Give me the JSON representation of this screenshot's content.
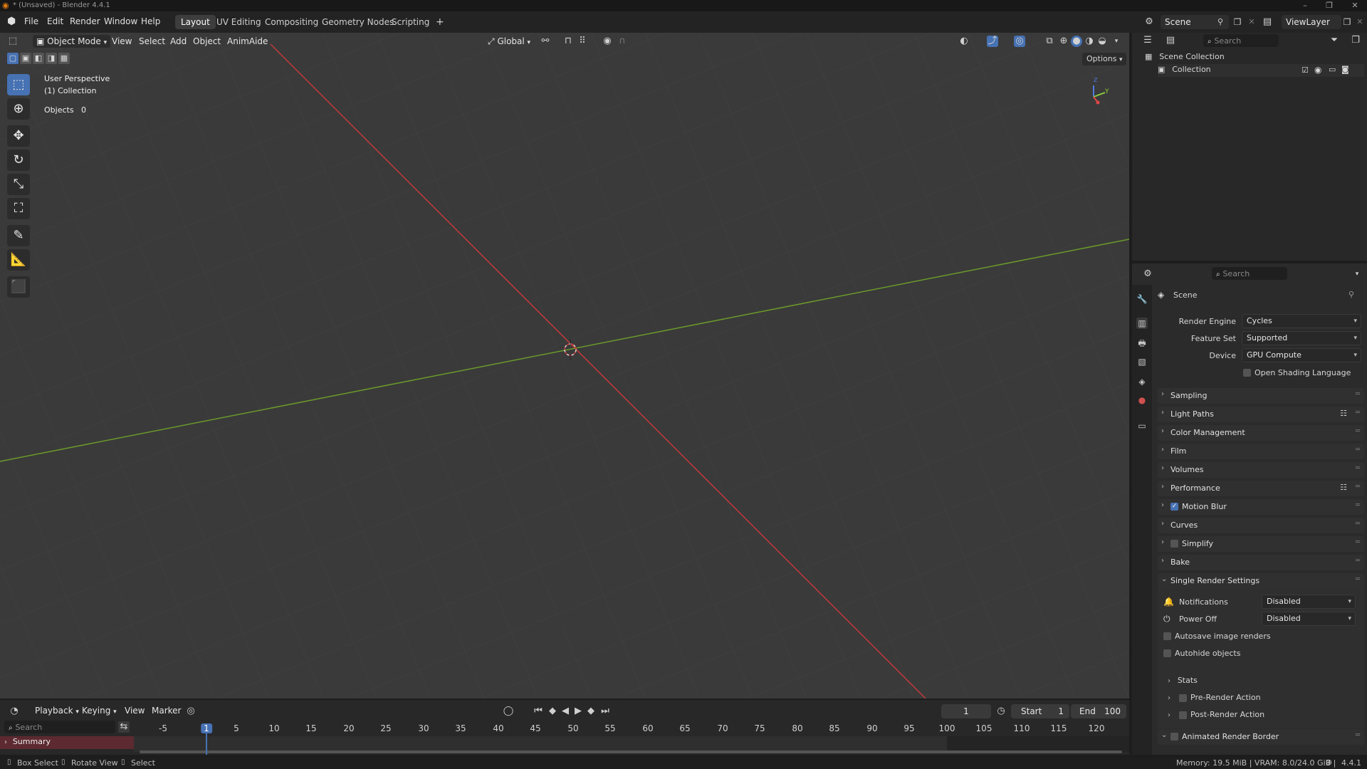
{
  "window": {
    "title": "* (Unsaved) - Blender 4.4.1"
  },
  "menus": [
    "File",
    "Edit",
    "Render",
    "Window",
    "Help"
  ],
  "workspaces": {
    "tabs": [
      "Layout",
      "UV Editing",
      "Compositing",
      "Geometry Nodes",
      "Scripting"
    ],
    "active": "Layout",
    "add": "+"
  },
  "scene_field": "Scene",
  "viewlayer_field": "ViewLayer",
  "viewport_header": {
    "mode": "Object Mode",
    "menus": [
      "View",
      "Select",
      "Add",
      "Object",
      "AnimAide"
    ],
    "transform": "Global",
    "options": "Options"
  },
  "overlay": {
    "perspective": "User Perspective",
    "collection": "(1) Collection",
    "objects_label": "Objects",
    "objects_value": "0"
  },
  "gizmo": {
    "z": "Z",
    "y": "Y"
  },
  "outliner": {
    "search_placeholder": "Search",
    "scene_collection": "Scene Collection",
    "collection": "Collection"
  },
  "properties": {
    "search_placeholder": "Search",
    "context": "Scene",
    "render_engine_label": "Render Engine",
    "render_engine": "Cycles",
    "feature_set_label": "Feature Set",
    "feature_set": "Supported",
    "device_label": "Device",
    "device": "GPU Compute",
    "osl_label": "Open Shading Language",
    "panels": [
      {
        "label": "Sampling"
      },
      {
        "label": "Light Paths"
      },
      {
        "label": "Color Management"
      },
      {
        "label": "Film"
      },
      {
        "label": "Volumes"
      },
      {
        "label": "Performance"
      },
      {
        "label": "Motion Blur"
      },
      {
        "label": "Curves"
      },
      {
        "label": "Simplify"
      },
      {
        "label": "Bake"
      },
      {
        "label": "Single Render Settings"
      }
    ],
    "single_render": {
      "notifications_label": "Notifications",
      "notifications": "Disabled",
      "power_off_label": "Power Off",
      "power_off": "Disabled",
      "autosave_label": "Autosave image renders",
      "autohide_label": "Autohide objects",
      "stats": "Stats",
      "pre_render": "Pre-Render Action",
      "post_render": "Post-Render Action"
    },
    "animated_border": "Animated Render Border"
  },
  "timeline": {
    "menus": [
      "Playback",
      "Keying",
      "View",
      "Marker"
    ],
    "current_frame": "1",
    "start_label": "Start",
    "start": "1",
    "end_label": "End",
    "end": "100",
    "search_placeholder": "Search",
    "summary": "Summary",
    "ticks": [
      "-5",
      "1",
      "5",
      "10",
      "15",
      "20",
      "25",
      "30",
      "35",
      "40",
      "45",
      "50",
      "55",
      "60",
      "65",
      "70",
      "75",
      "80",
      "85",
      "90",
      "95",
      "100",
      "105",
      "110",
      "115",
      "120"
    ]
  },
  "statusbar": {
    "box_select": "Box Select",
    "rotate_view": "Rotate View",
    "select": "Select",
    "memory": "Memory: 19.5 MiB | VRAM: 8.0/24.0 GiB | ",
    "version": "4.4.1"
  }
}
